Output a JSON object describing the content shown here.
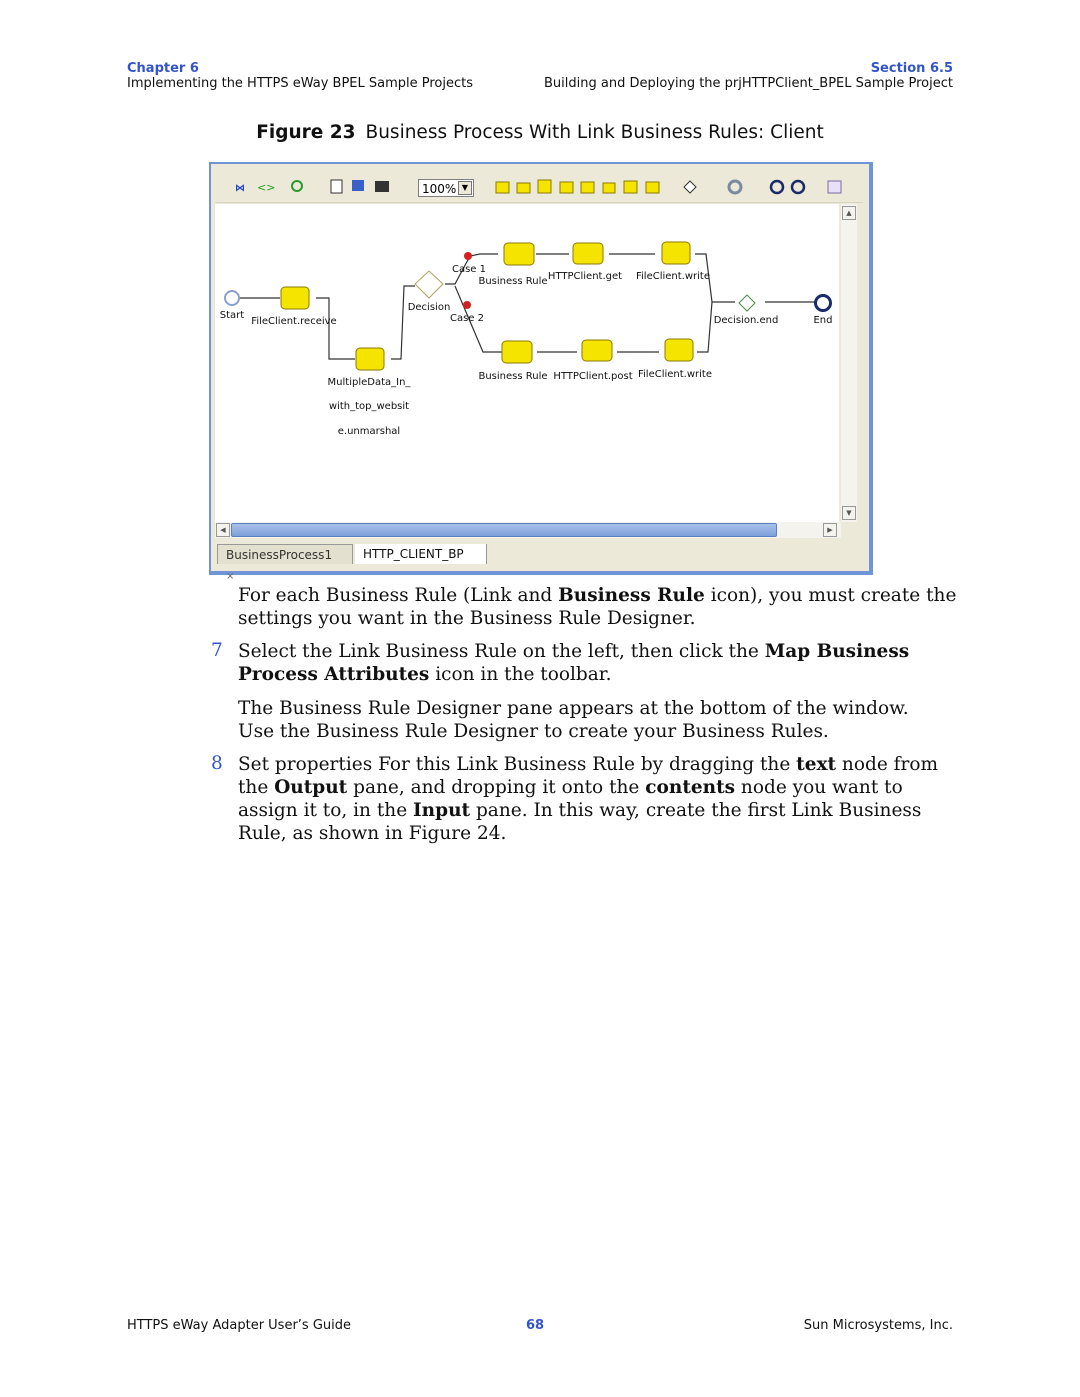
{
  "header": {
    "chapter": "Chapter 6",
    "chapter_title": "Implementing the HTTPS eWay BPEL Sample Projects",
    "section": "Section 6.5",
    "section_title": "Building and Deploying the prjHTTPClient_BPEL Sample Project"
  },
  "figure": {
    "label": "Figure 23",
    "caption": "Business Process With Link Business Rules: Client",
    "toolbar": {
      "zoom": "100%",
      "icons": [
        "map-attributes-icon",
        "source-code-icon",
        "sync-icon",
        "validate-icon",
        "deploy-icon",
        "print-icon",
        "receive-icon",
        "reply-icon",
        "invoke-icon",
        "assign-icon",
        "wait-icon",
        "empty-icon",
        "while-icon",
        "throw-icon",
        "decision-icon",
        "event-icon",
        "timer-icon",
        "terminate-icon",
        "compensate-icon"
      ]
    },
    "nodes": {
      "start": "Start",
      "end": "End",
      "file_receive": "FileClient.receive",
      "unmarshal": [
        "MultipleData_In_",
        "with_top_websit",
        "e.unmarshal"
      ],
      "decision": "Decision",
      "decision_end": "Decision.end",
      "case1": "Case 1",
      "case2": "Case 2",
      "top": {
        "rule": "Business Rule",
        "http": "HTTPClient.get",
        "write": "FileClient.write"
      },
      "bottom": {
        "rule": "Business Rule",
        "http": "HTTPClient.post",
        "write": "FileClient.write"
      }
    },
    "tabs": [
      "BusinessProcess1",
      "HTTP_CLIENT_BP"
    ],
    "tab_close": "×",
    "colors": {
      "node": "#f5e400",
      "border": "#6f95d6",
      "case": "#d42020"
    }
  },
  "content": {
    "p1": {
      "a": "For each Business Rule (Link and ",
      "b": "Business Rule",
      "c": " icon), you must create the settings you want in the Business Rule Designer."
    },
    "step7": {
      "num": "7",
      "a": "Select the Link Business Rule on the left, then click the ",
      "b": "Map Business Process Attributes",
      "c": " icon in the toolbar."
    },
    "p2": "The Business Rule Designer pane appears at the bottom of the window. Use the Business Rule Designer to create your Business Rules.",
    "step8": {
      "num": "8",
      "a": "Set properties For this Link Business Rule by dragging the ",
      "b": "text",
      "c": " node from the ",
      "d": "Output",
      "e": " pane, and dropping it onto the ",
      "f": "contents",
      "g": " node you want to assign it to, in the ",
      "h": "Input",
      "i": " pane. In this way, create the first Link Business Rule, as shown in Figure 24."
    }
  },
  "footer": {
    "left": "HTTPS eWay Adapter User’s Guide",
    "page": "68",
    "right": "Sun Microsystems, Inc."
  }
}
